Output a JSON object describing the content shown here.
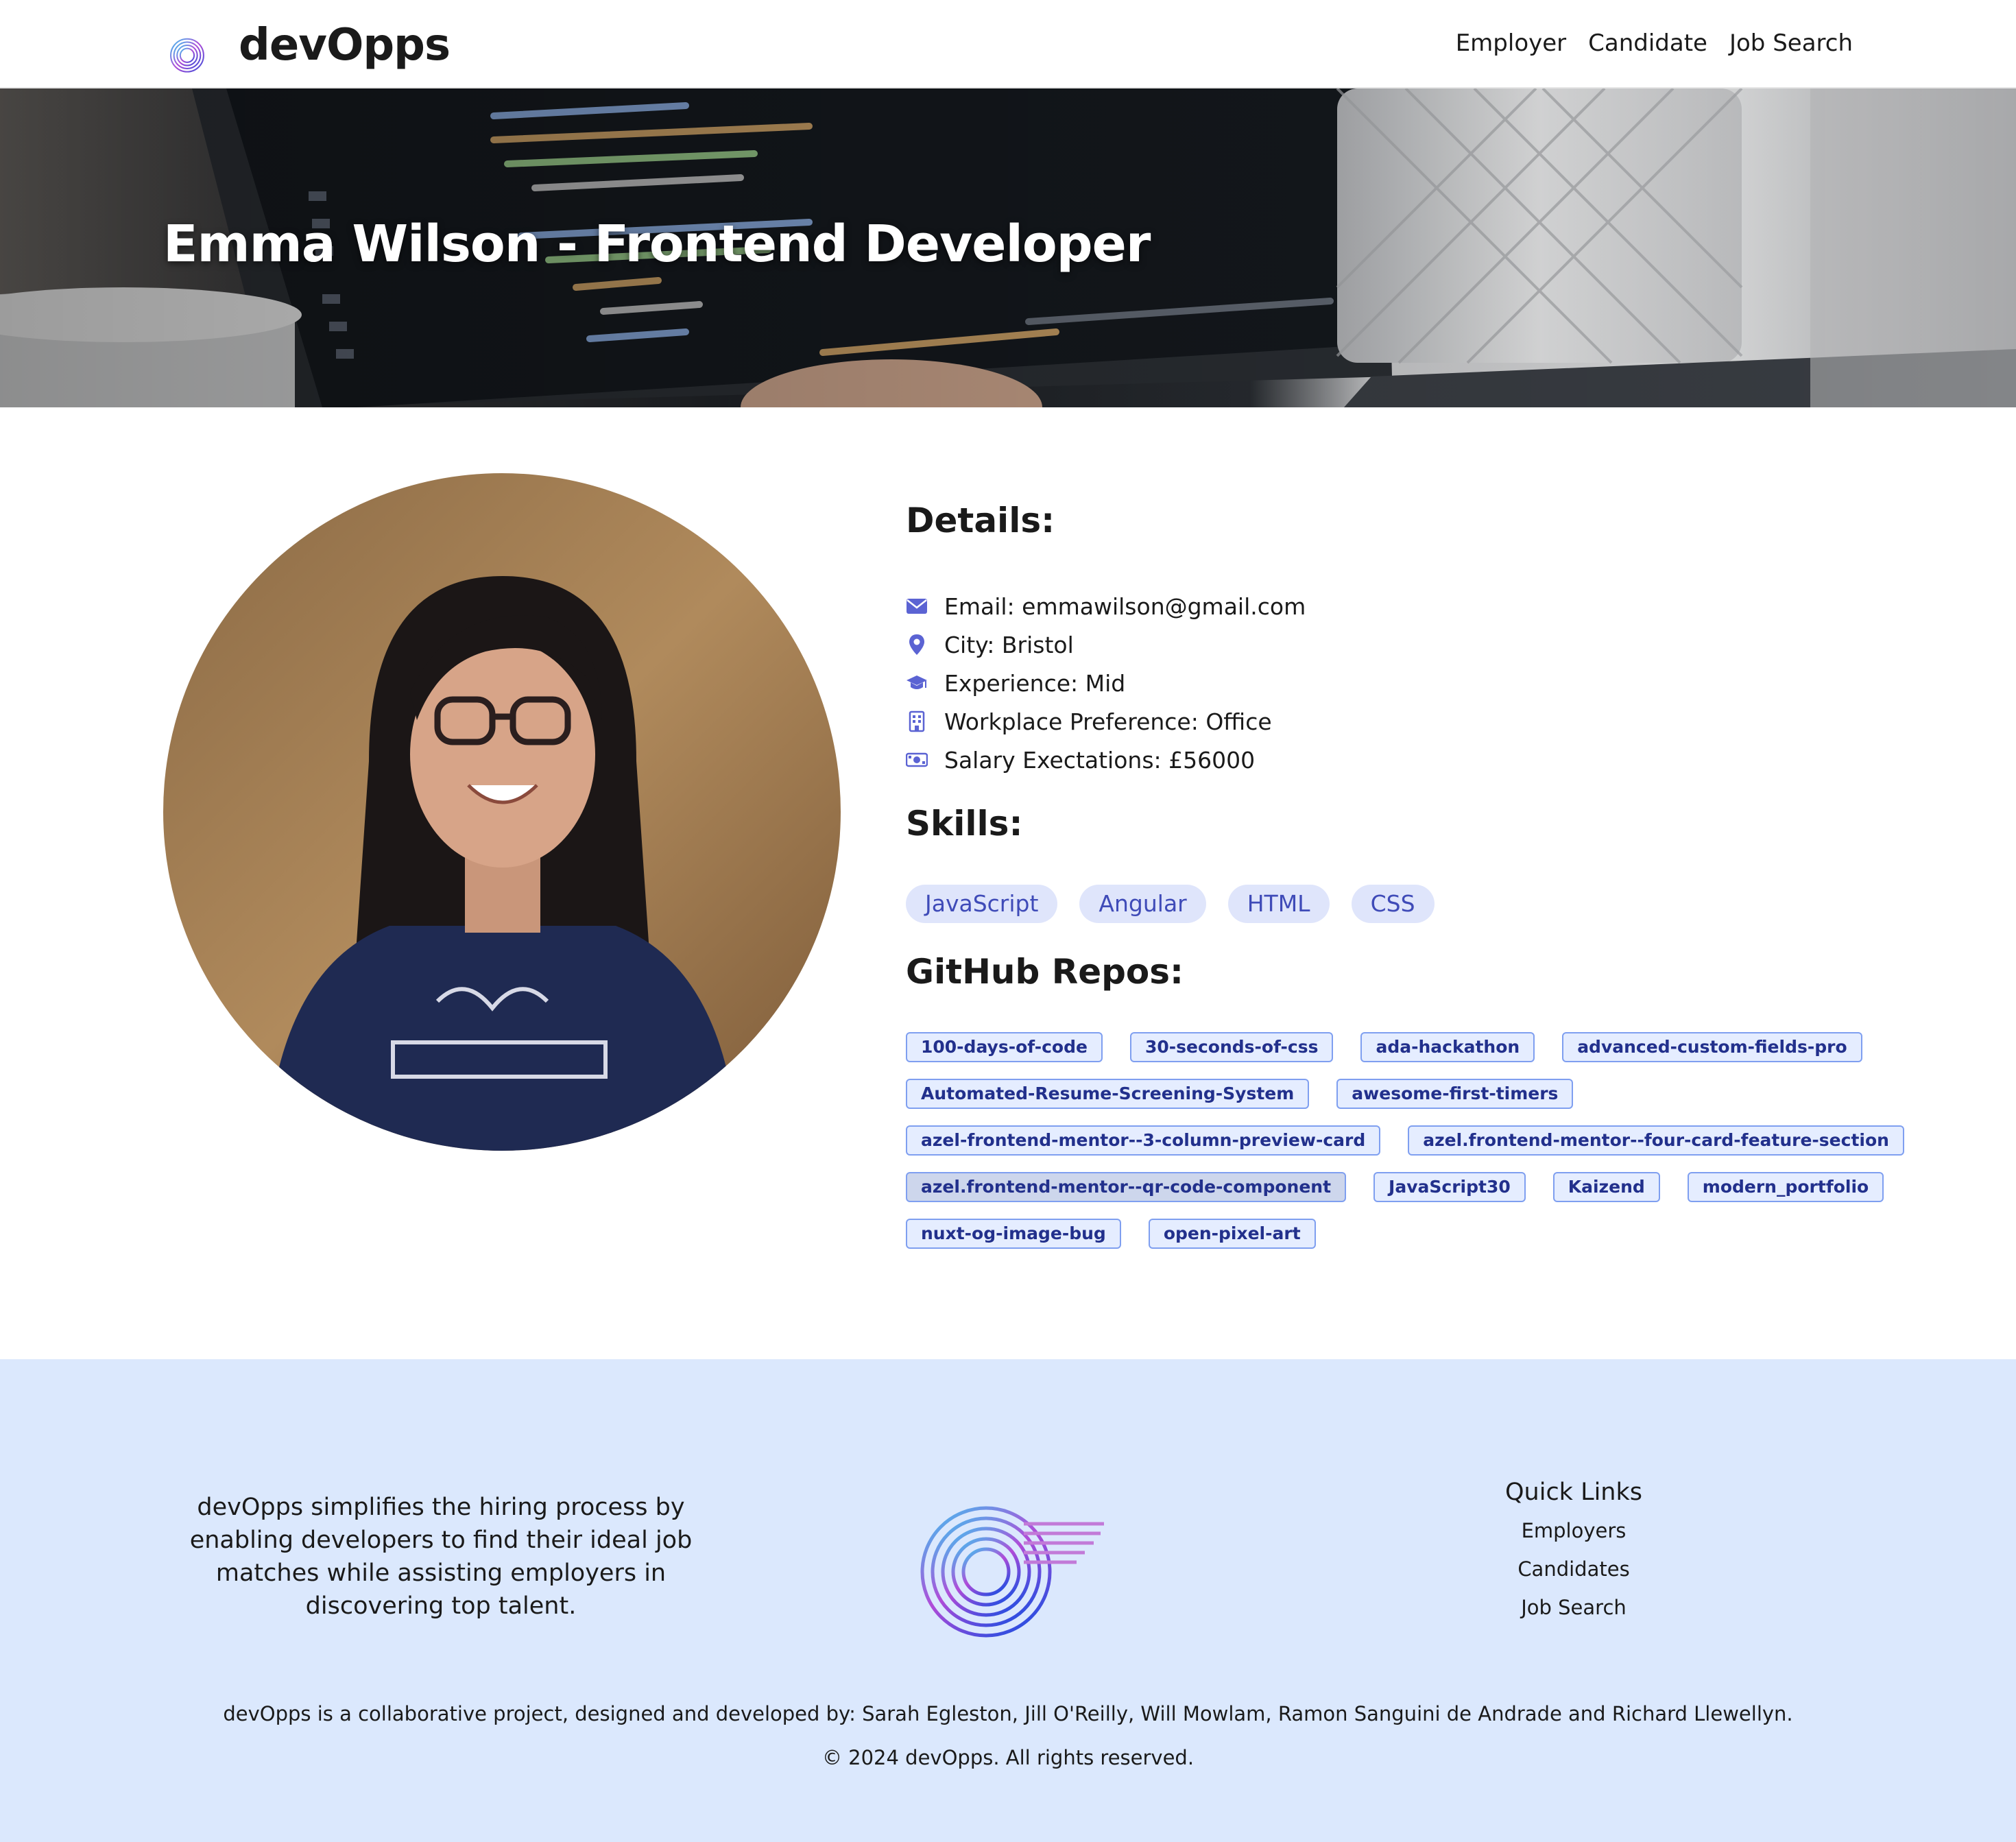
{
  "brand": {
    "name": "devOpps"
  },
  "nav": {
    "links": [
      "Employer",
      "Candidate",
      "Job Search"
    ]
  },
  "hero": {
    "title": "Emma Wilson - Frontend Developer"
  },
  "profile": {
    "details_title": "Details:",
    "details": [
      {
        "icon": "envelope-icon",
        "text": "Email: emmawilson@gmail.com"
      },
      {
        "icon": "map-pin-icon",
        "text": "City: Bristol"
      },
      {
        "icon": "graduation-cap-icon",
        "text": "Experience: Mid"
      },
      {
        "icon": "building-icon",
        "text": "Workplace Preference: Office"
      },
      {
        "icon": "money-bill-icon",
        "text": "Salary Exectations: £56000"
      }
    ],
    "skills_title": "Skills:",
    "skills": [
      "JavaScript",
      "Angular",
      "HTML",
      "CSS"
    ],
    "repos_title": "GitHub Repos:",
    "repos": [
      [
        "100-days-of-code",
        "30-seconds-of-css",
        "ada-hackathon",
        "advanced-custom-fields-pro"
      ],
      [
        "Automated-Resume-Screening-System",
        "awesome-first-timers"
      ],
      [
        "azel-frontend-mentor--3-column-preview-card",
        "azel.frontend-mentor--four-card-feature-section"
      ],
      [
        "azel.frontend-mentor--qr-code-component",
        "JavaScript30",
        "Kaizend",
        "modern_portfolio"
      ],
      [
        "nuxt-og-image-bug",
        "open-pixel-art"
      ]
    ],
    "selected_repo": "azel.frontend-mentor--qr-code-component"
  },
  "footer": {
    "blurb": "devOpps simplifies the hiring process by enabling developers to find their ideal job matches while assisting employers in discovering top talent.",
    "quick_links_title": "Quick Links",
    "quick_links": [
      "Employers",
      "Candidates",
      "Job Search"
    ],
    "credits": "devOpps is a collaborative project, designed and developed by: Sarah Egleston, Jill O'Reilly, Will Mowlam, Ramon Sanguini de Andrade and Richard Llewellyn.",
    "copyright": "© 2024 devOpps. All rights reserved."
  },
  "colors": {
    "accent": "#5b63d3",
    "skill_pill_bg": "#dfe5fb",
    "repo_tag_border": "#7f9ff0",
    "footer_bg": "#dbe8fd"
  }
}
